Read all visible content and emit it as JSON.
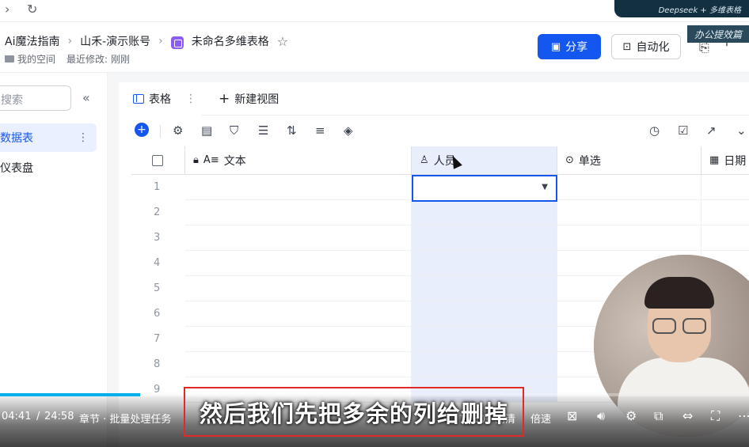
{
  "browser": {
    "forward_icon": "chevron-right-icon",
    "reload_icon": "reload-icon"
  },
  "promo": {
    "banner_text": "Deepseek + 多维表格",
    "tag_text": "办公提效篇"
  },
  "header": {
    "breadcrumb": [
      "Ai魔法指南",
      "山禾-演示账号",
      "未命名多维表格"
    ],
    "workspace_label": "我的空间",
    "last_modified": "最近修改: 刚刚",
    "share_label": "分享",
    "automation_label": "自动化",
    "accent_color": "#1456f0"
  },
  "sidebar": {
    "search_placeholder": "搜索",
    "items": [
      {
        "label": "数据表",
        "active": true
      },
      {
        "label": "仪表盘",
        "active": false
      }
    ]
  },
  "view_tabs": {
    "active_label": "表格",
    "new_view_label": "新建视图"
  },
  "table": {
    "columns": [
      {
        "label": "文本",
        "icon": "text-field-icon"
      },
      {
        "label": "人员",
        "icon": "person-icon"
      },
      {
        "label": "单选",
        "icon": "single-select-icon"
      },
      {
        "label": "日期",
        "icon": "calendar-icon"
      }
    ],
    "rows": [
      "1",
      "2",
      "3",
      "4",
      "5",
      "6",
      "7",
      "8",
      "9"
    ]
  },
  "video": {
    "time_current": "04:41",
    "time_separator": "/",
    "time_total": "24:58",
    "chapter_label": "章节 · 批量处理任务",
    "quality": "1080P 高清",
    "speed_label": "倍速",
    "progress": 0.187,
    "subtitle": "然后我们先把多余的列给删掉"
  }
}
